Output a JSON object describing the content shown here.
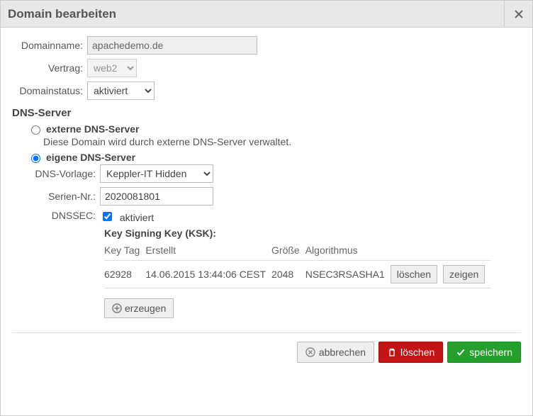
{
  "title": "Domain bearbeiten",
  "labels": {
    "domainname": "Domainname:",
    "contract": "Vertrag:",
    "status": "Domainstatus:",
    "dns_section": "DNS-Server",
    "radio_external": "externe DNS-Server",
    "radio_external_desc": "Diese Domain wird durch externe DNS-Server verwaltet.",
    "radio_own": "eigene DNS-Server",
    "dns_template": "DNS-Vorlage:",
    "serial": "Serien-Nr.:",
    "dnssec": "DNSSEC:",
    "dnssec_active": "aktiviert",
    "ksk_title": "Key Signing Key (KSK):",
    "col_keytag": "Key Tag",
    "col_created": "Erstellt",
    "col_size": "Größe",
    "col_algo": "Algorithmus",
    "btn_row_delete": "löschen",
    "btn_row_show": "zeigen",
    "btn_create": "erzeugen",
    "btn_cancel": "abbrechen",
    "btn_delete": "löschen",
    "btn_save": "speichern"
  },
  "values": {
    "domainname": "apachedemo.de",
    "contract": "web2",
    "status": "aktiviert",
    "dns_mode": "own",
    "dns_template": "Keppler-IT Hidden",
    "serial": "2020081801",
    "dnssec_active": true
  },
  "ksk_rows": [
    {
      "keytag": "62928",
      "created": "14.06.2015 13:44:06 CEST",
      "size": "2048",
      "algo": "NSEC3RSASHA1"
    }
  ]
}
